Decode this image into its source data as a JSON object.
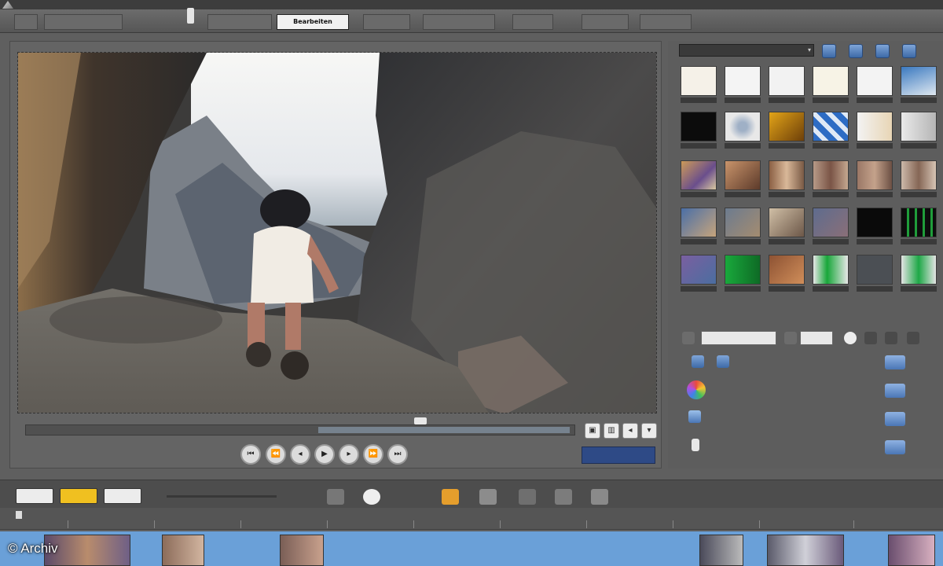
{
  "credit": "© Archiv",
  "tabs": [
    {
      "label": "",
      "active": false
    },
    {
      "label": "",
      "active": false
    },
    {
      "label": "",
      "active": false
    },
    {
      "label": "Bearbeiten",
      "active": true
    },
    {
      "label": "",
      "active": false
    },
    {
      "label": "",
      "active": false
    },
    {
      "label": "",
      "active": false
    },
    {
      "label": "",
      "active": false
    },
    {
      "label": "",
      "active": false
    }
  ],
  "colors": {
    "timecode_bg": "#2e4a86",
    "track_bg": "#6aa0d8",
    "active_tab": "#f1f1f1"
  }
}
